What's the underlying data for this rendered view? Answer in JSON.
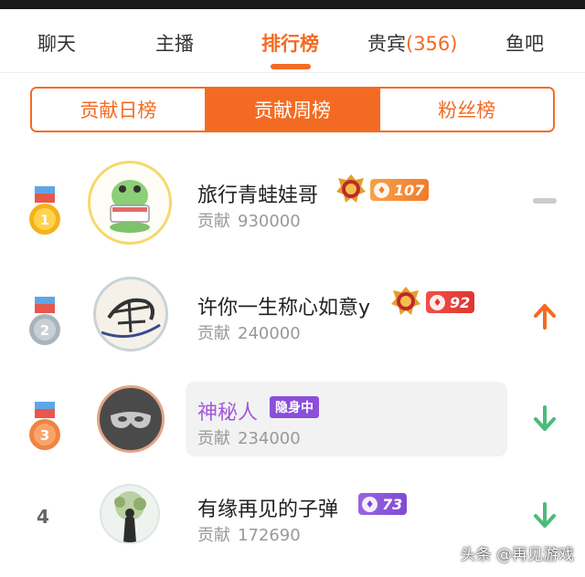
{
  "tabs": [
    {
      "label": "聊天",
      "active": false
    },
    {
      "label": "主播",
      "active": false
    },
    {
      "label": "排行榜",
      "active": true
    },
    {
      "label": "贵宾",
      "count": "(356)",
      "active": false
    },
    {
      "label": "鱼吧",
      "active": false
    }
  ],
  "segments": [
    {
      "label": "贡献日榜",
      "active": false
    },
    {
      "label": "贡献周榜",
      "active": true
    },
    {
      "label": "粉丝榜",
      "active": false
    }
  ],
  "ranking": [
    {
      "rank": "1",
      "name": "旅行青蛙娃哥",
      "level": "107",
      "contrib_label": "贡献",
      "contrib": "930000",
      "trend": "same"
    },
    {
      "rank": "2",
      "name": "许你一生称心如意y",
      "level": "92",
      "contrib_label": "贡献",
      "contrib": "240000",
      "trend": "up"
    },
    {
      "rank": "3",
      "name": "神秘人",
      "tag": "隐身中",
      "contrib_label": "贡献",
      "contrib": "234000",
      "trend": "down"
    },
    {
      "rank": "4",
      "name": "有缘再见的子弹",
      "level": "73",
      "contrib_label": "贡献",
      "contrib": "172690",
      "trend": "down"
    }
  ],
  "watermark": "头条 @再见游戏",
  "colors": {
    "accent": "#f36b23",
    "trend_up": "#f36b23",
    "trend_down": "#4cbb7a",
    "trend_same": "#cccccc",
    "stealth_tag": "#8b4fdb",
    "gold": "#f6b21c",
    "silver": "#a9b3bb",
    "bronze": "#f08443"
  },
  "icons": {
    "medal_1": "gold-medal-icon",
    "medal_2": "silver-medal-icon",
    "medal_3": "bronze-medal-icon",
    "noble": "noble-crest-icon",
    "trend_up": "arrow-up-icon",
    "trend_down": "arrow-down-icon",
    "trend_same": "dash-icon"
  }
}
